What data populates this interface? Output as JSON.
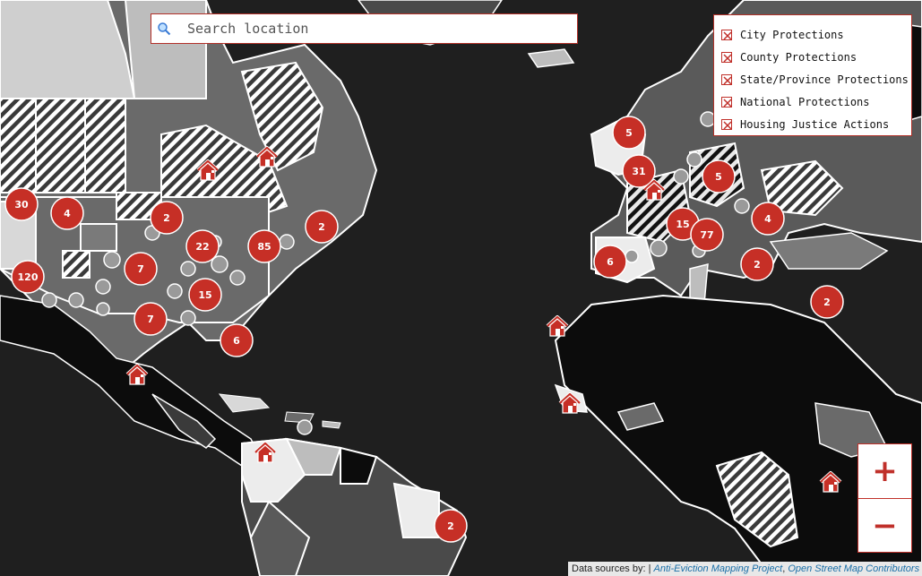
{
  "search": {
    "placeholder": "Search location"
  },
  "legend": {
    "items": [
      {
        "label": "City Protections",
        "checked": true
      },
      {
        "label": "County Protections",
        "checked": true
      },
      {
        "label": "State/Province Protections",
        "checked": true
      },
      {
        "label": "National Protections",
        "checked": true
      },
      {
        "label": "Housing Justice Actions",
        "checked": true
      }
    ]
  },
  "zoom": {
    "in_label": "+",
    "out_label": "−"
  },
  "attribution": {
    "prefix": "Data sources by: | ",
    "source1": "Anti-Eviction Mapping Project",
    "separator": ", ",
    "source2": "Open Street Map Contributors"
  },
  "clusters": [
    {
      "label": "30"
    },
    {
      "label": "4"
    },
    {
      "label": "2"
    },
    {
      "label": "2"
    },
    {
      "label": "22"
    },
    {
      "label": "85"
    },
    {
      "label": "7"
    },
    {
      "label": "120"
    },
    {
      "label": "15"
    },
    {
      "label": "7"
    },
    {
      "label": "6"
    },
    {
      "label": "5"
    },
    {
      "label": "31"
    },
    {
      "label": "5"
    },
    {
      "label": "15"
    },
    {
      "label": "77"
    },
    {
      "label": "4"
    },
    {
      "label": "6"
    },
    {
      "label": "2"
    },
    {
      "label": "2"
    },
    {
      "label": "2"
    }
  ],
  "colors": {
    "accent": "#c62f26",
    "ocean": "#1f1f1f",
    "land_dark": "#0c0c0c",
    "land_mid": "#5a5a5a",
    "land_light": "#bdbdbd"
  }
}
